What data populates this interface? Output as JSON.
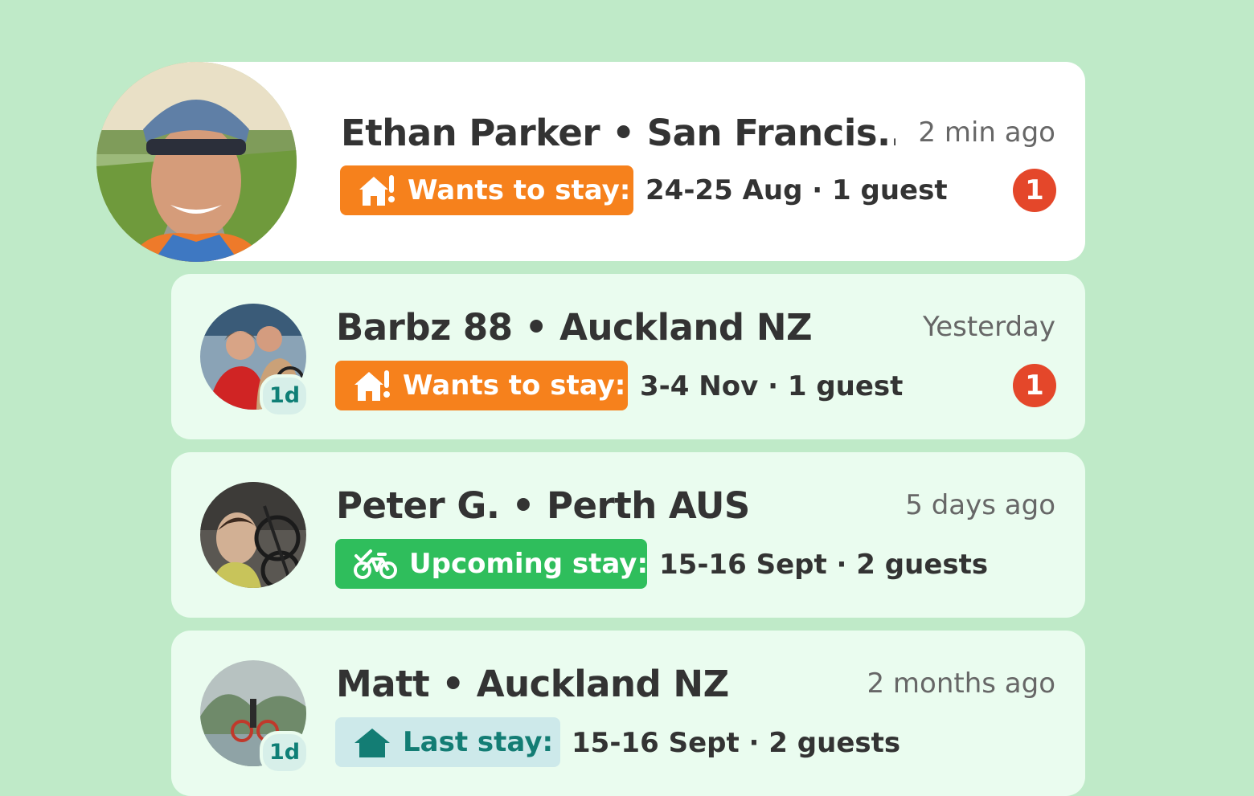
{
  "colors": {
    "background": "#bfeac8",
    "card_featured": "#ffffff",
    "card": "#eafcef",
    "wants_pill": "#f6811c",
    "upcoming_pill": "#2fbe5c",
    "last_pill_bg": "#cde9ea",
    "last_pill_text": "#137d74",
    "unread_badge": "#e4472a"
  },
  "conversations": [
    {
      "title": "Ethan Parker • San Francis...",
      "time": "2 min ago",
      "status_label": "Wants to stay:",
      "status_icon": "house-alert-icon",
      "details": "24-25 Aug · 1 guest",
      "unread": "1"
    },
    {
      "title": "Barbz 88 • Auckland NZ",
      "time": "Yesterday",
      "status_label": "Wants to stay:",
      "status_icon": "house-alert-icon",
      "details": "3-4 Nov · 1 guest",
      "unread": "1",
      "age_badge": "1d"
    },
    {
      "title": "Peter G. • Perth AUS",
      "time": "5 days ago",
      "status_label": "Upcoming stay:",
      "status_icon": "bike-check-icon",
      "details": "15-16 Sept · 2 guests"
    },
    {
      "title": "Matt • Auckland NZ",
      "time": "2 months ago",
      "status_label": "Last stay:",
      "status_icon": "house-icon",
      "details": "15-16 Sept · 2 guests",
      "age_badge": "1d"
    }
  ]
}
